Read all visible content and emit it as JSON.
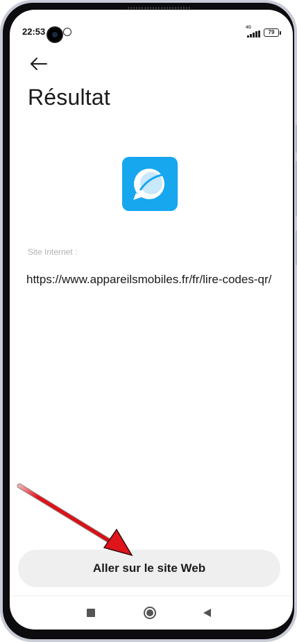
{
  "status": {
    "time": "22:53",
    "network": "4G",
    "battery": "79"
  },
  "page": {
    "title": "Résultat"
  },
  "result": {
    "field_label": "Site Internet :",
    "url": "https://www.appareilsmobiles.fr/fr/lire-codes-qr/"
  },
  "actions": {
    "primary_label": "Aller sur le site Web"
  },
  "icons": {
    "back": "arrow-left-icon",
    "app": "browser-chat-bubble-icon",
    "nav_recents": "square-icon",
    "nav_home": "circle-icon",
    "nav_back": "triangle-left-icon"
  },
  "colors": {
    "app_icon": "#16a7ef",
    "annotation_arrow": "#e0141b",
    "button_bg": "#efefef"
  }
}
